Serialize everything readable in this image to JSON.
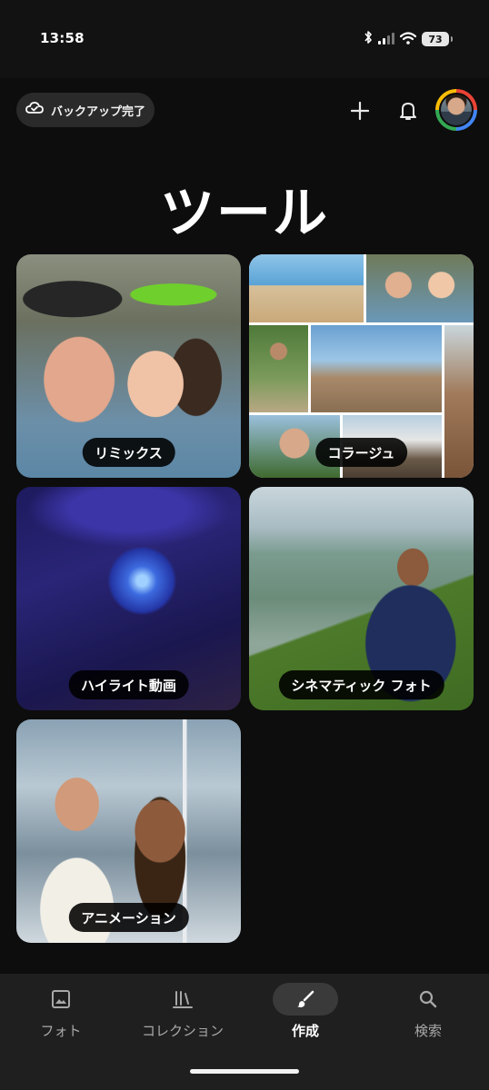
{
  "status_bar": {
    "time": "13:58",
    "battery": "73"
  },
  "header": {
    "backup_label": "バックアップ完了"
  },
  "page": {
    "title": "ツール"
  },
  "tools": [
    {
      "label": "リミックス"
    },
    {
      "label": "コラージュ"
    },
    {
      "label": "ハイライト動画"
    },
    {
      "label": "シネマティック フォト"
    },
    {
      "label": "アニメーション"
    }
  ],
  "bottom_nav": {
    "items": [
      {
        "label": "フォト",
        "icon": "photo-icon"
      },
      {
        "label": "コレクション",
        "icon": "library-icon"
      },
      {
        "label": "作成",
        "icon": "brush-icon",
        "active": true
      },
      {
        "label": "検索",
        "icon": "search-icon"
      }
    ]
  }
}
